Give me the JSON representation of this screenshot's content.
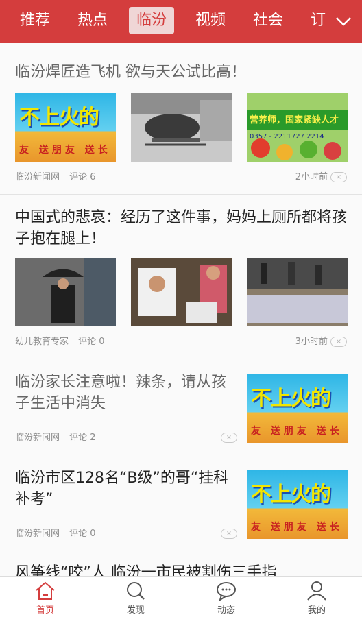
{
  "nav": {
    "tabs": [
      "推荐",
      "热点",
      "临汾",
      "视频",
      "社会",
      "订"
    ],
    "active_index": 2,
    "more_icon": "chevron-down-icon"
  },
  "colors": {
    "brand": "#d43d3d",
    "active_tab_bg": "#f0d6d6"
  },
  "articles": [
    {
      "title": "临汾焊匠造飞机 欲与天公试比高！",
      "source": "临汾新闻网",
      "comments": "评论 6",
      "time": "2小时前",
      "thumb_texts": [
        "不上火的",
        "友 送朋友 送长"
      ],
      "ad_texts": [
        "营养师，国家紧缺人才",
        "0357 - 2211727 2214"
      ]
    },
    {
      "title": "中国式的悲哀：经历了这件事，妈妈上厕所都将孩子抱在腿上！",
      "source": "幼儿教育专家",
      "comments": "评论 0",
      "time": "3小时前"
    },
    {
      "title": "临汾家长注意啦！辣条，请从孩子生活中消失",
      "source": "临汾新闻网",
      "comments": "评论 2"
    },
    {
      "title": "临汾市区128名“B级”的哥“挂科补考”",
      "source": "临汾新闻网",
      "comments": "评论 0"
    },
    {
      "title": "风筝线“咬”人 临汾一市民被割伤三手指"
    }
  ],
  "dismiss_label": "×",
  "bottom_nav": [
    {
      "label": "首页",
      "icon": "home-icon"
    },
    {
      "label": "发现",
      "icon": "search-icon"
    },
    {
      "label": "动态",
      "icon": "chat-bubble-icon"
    },
    {
      "label": "我的",
      "icon": "person-icon"
    }
  ]
}
